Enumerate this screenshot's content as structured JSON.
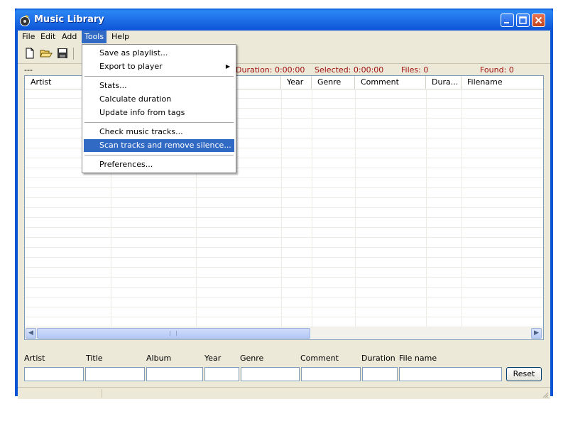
{
  "window": {
    "title": "Music Library"
  },
  "menubar": {
    "items": [
      "File",
      "Edit",
      "Add",
      "Tools",
      "Help"
    ]
  },
  "status": {
    "left": "---",
    "duration": "Duration: 0:00:00",
    "selected": "Selected: 0:00:00",
    "files": "Files: 0",
    "found": "Found: 0"
  },
  "table": {
    "headers": [
      "Artist",
      "",
      "",
      "Year",
      "Genre",
      "Comment",
      "Dura...",
      "Filename"
    ]
  },
  "filters": {
    "labels": [
      "Artist",
      "Title",
      "Album",
      "Year",
      "Genre",
      "Comment",
      "Duration",
      "File name"
    ],
    "values": [
      "",
      "",
      "",
      "",
      "",
      "",
      "",
      ""
    ],
    "reset_label": "Reset"
  },
  "tools_menu": {
    "items": [
      {
        "label": "Save as playlist..."
      },
      {
        "label": "Export to player",
        "submenu": true
      },
      {
        "label": "Stats..."
      },
      {
        "label": "Calculate duration"
      },
      {
        "label": "Update info from tags"
      },
      {
        "label": "Check music tracks..."
      },
      {
        "label": "Scan tracks and remove silence...",
        "highlighted": true
      },
      {
        "label": "Preferences..."
      }
    ]
  },
  "colors": {
    "titlebar": "#0a53d6",
    "highlight": "#316ac5",
    "status_red": "#a01010",
    "client": "#ece9d8"
  }
}
